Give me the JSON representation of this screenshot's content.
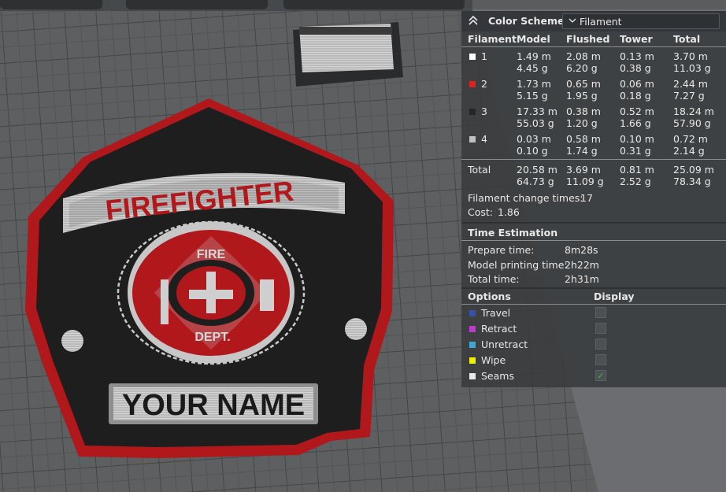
{
  "badge": {
    "title": "FIREFIGHTER",
    "seal_top": "FIRE",
    "seal_bottom": "DEPT.",
    "name": "YOUR NAME"
  },
  "panel": {
    "title": "Color Scheme",
    "scheme_value": "Filament",
    "columns": [
      "Filament",
      "Model",
      "Flushed",
      "Tower",
      "Total"
    ],
    "rows": [
      {
        "id": "1",
        "color": "#ffffff",
        "model": [
          "1.49 m",
          "4.45 g"
        ],
        "flushed": [
          "2.08 m",
          "6.20 g"
        ],
        "tower": [
          "0.13 m",
          "0.38 g"
        ],
        "total": [
          "3.70 m",
          "11.03 g"
        ]
      },
      {
        "id": "2",
        "color": "#e02020",
        "model": [
          "1.73 m",
          "5.15 g"
        ],
        "flushed": [
          "0.65 m",
          "1.95 g"
        ],
        "tower": [
          "0.06 m",
          "0.18 g"
        ],
        "total": [
          "2.44 m",
          "7.27 g"
        ]
      },
      {
        "id": "3",
        "color": "#262626",
        "model": [
          "17.33 m",
          "55.03 g"
        ],
        "flushed": [
          "0.38 m",
          "1.20 g"
        ],
        "tower": [
          "0.52 m",
          "1.66 g"
        ],
        "total": [
          "18.24 m",
          "57.90 g"
        ]
      },
      {
        "id": "4",
        "color": "#c0c0c0",
        "model": [
          "0.03 m",
          "0.10 g"
        ],
        "flushed": [
          "0.58 m",
          "1.74 g"
        ],
        "tower": [
          "0.10 m",
          "0.31 g"
        ],
        "total": [
          "0.72 m",
          "2.14 g"
        ]
      }
    ],
    "total_row": {
      "label": "Total",
      "model": [
        "20.58 m",
        "64.73 g"
      ],
      "flushed": [
        "3.69 m",
        "11.09 g"
      ],
      "tower": [
        "0.81 m",
        "2.52 g"
      ],
      "total": [
        "25.09 m",
        "78.34 g"
      ]
    },
    "change_times_label": "Filament change times:",
    "change_times_value": "17",
    "cost_label": "Cost:",
    "cost_value": "1.86",
    "time_section": "Time Estimation",
    "times": [
      {
        "label": "Prepare time:",
        "value": "8m28s"
      },
      {
        "label": "Model printing time:",
        "value": "2h22m"
      },
      {
        "label": "Total time:",
        "value": "2h31m"
      }
    ],
    "options_header": "Options",
    "display_header": "Display",
    "options": [
      {
        "label": "Travel",
        "color": "#3a4fa8",
        "checked": false
      },
      {
        "label": "Retract",
        "color": "#c03ad0",
        "checked": false
      },
      {
        "label": "Unretract",
        "color": "#3aa8d0",
        "checked": false
      },
      {
        "label": "Wipe",
        "color": "#f0f000",
        "checked": false
      },
      {
        "label": "Seams",
        "color": "#e8e8e8",
        "checked": true
      }
    ]
  }
}
